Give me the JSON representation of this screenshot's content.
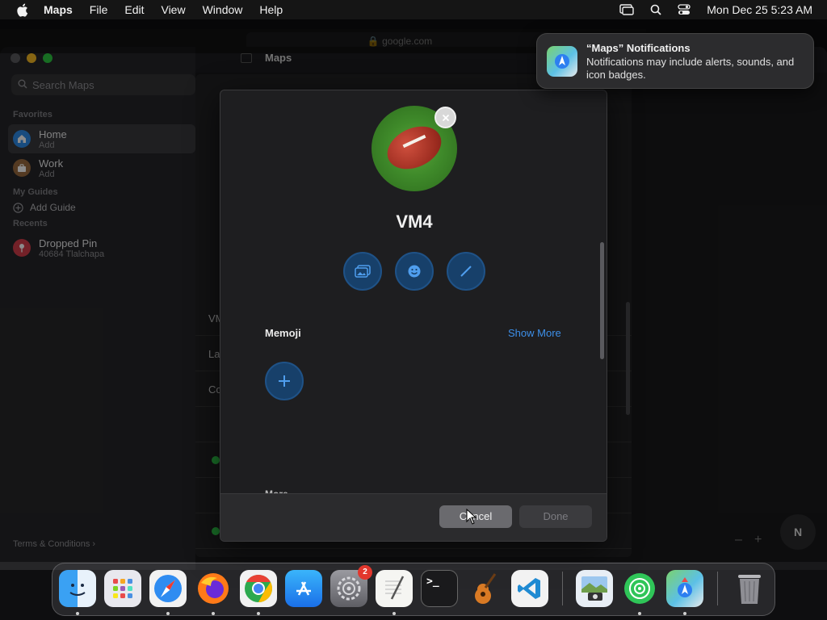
{
  "menubar": {
    "app": "Maps",
    "items": [
      "File",
      "Edit",
      "View",
      "Window",
      "Help"
    ],
    "datetime": "Mon Dec 25  5:23 AM"
  },
  "browser": {
    "url": "google.com"
  },
  "maps": {
    "window_title": "Maps",
    "search_placeholder": "Search Maps",
    "favorites_header": "Favorites",
    "home": {
      "title": "Home",
      "subtitle": "Add"
    },
    "work": {
      "title": "Work",
      "subtitle": "Add"
    },
    "guides_header": "My Guides",
    "add_guide": "Add Guide",
    "recents_header": "Recents",
    "recent": {
      "title": "Dropped Pin",
      "subtitle": "40684 Tlalchapa"
    },
    "terms": "Terms & Conditions",
    "compass": "N",
    "zoom_out": "–",
    "zoom_in": "+",
    "partial_rows": [
      "VM",
      "La",
      "Co"
    ]
  },
  "modal": {
    "name": "VM4",
    "memoji_label": "Memoji",
    "show_more": "Show More",
    "more_label": "More",
    "cancel": "Cancel",
    "done": "Done"
  },
  "notification": {
    "title": "“Maps” Notifications",
    "body": "Notifications may include alerts, sounds, and icon badges."
  },
  "dock": {
    "settings_badge": "2",
    "terminal_glyph": ">_"
  },
  "colors": {
    "accent_blue": "#3d8fe8",
    "circle_button": "#17406a",
    "badge_red": "#e2372d",
    "status_green": "#2ecc49"
  }
}
